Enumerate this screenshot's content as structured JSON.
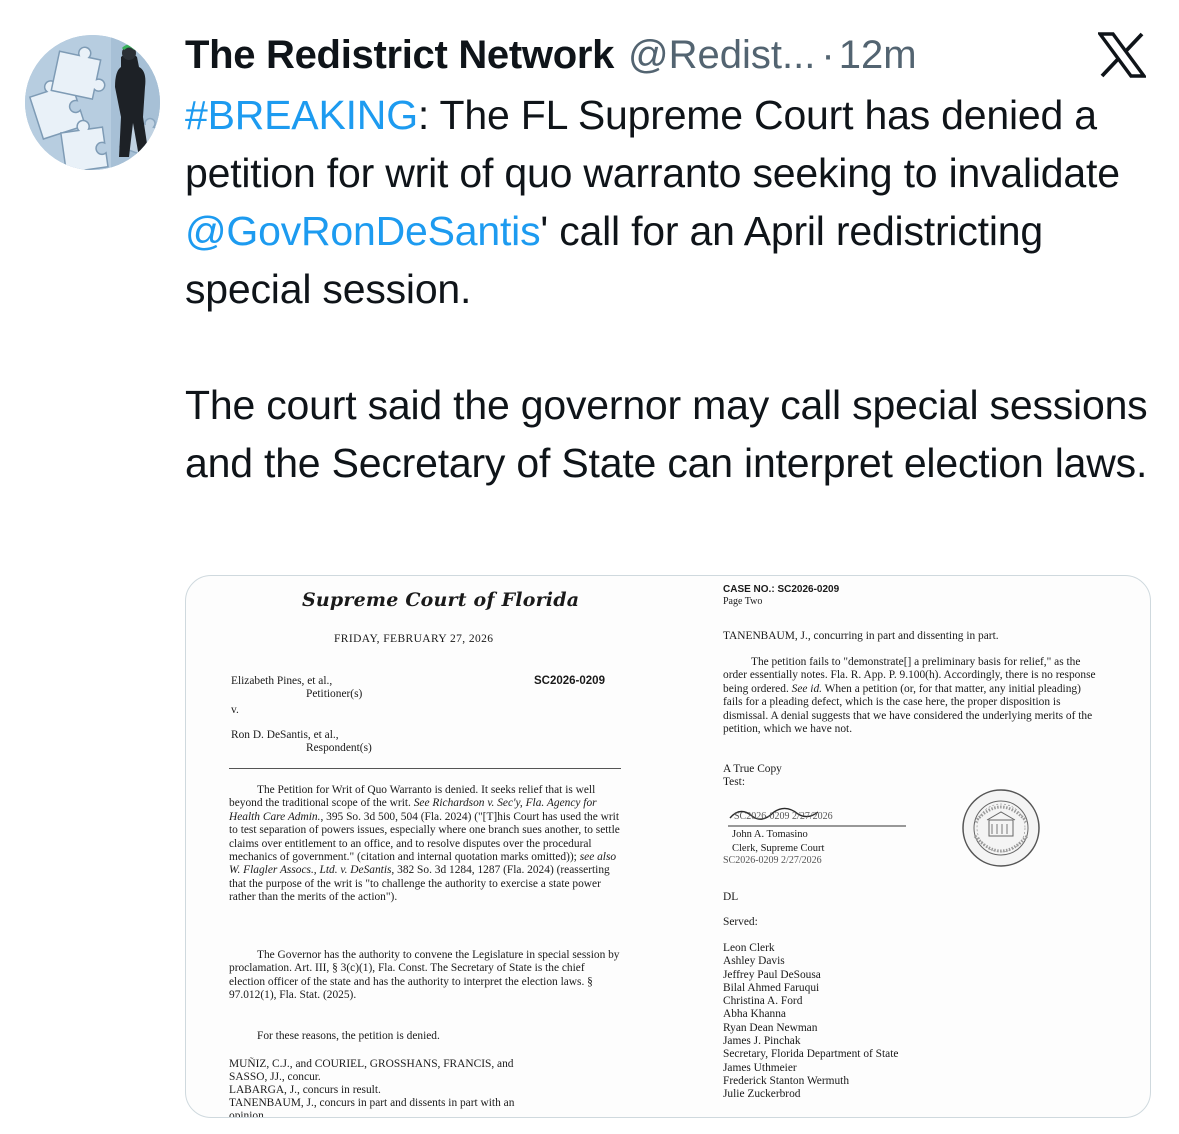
{
  "author": {
    "name": "The Redistrict Network",
    "handle": "@Redist...",
    "separator": "·",
    "time": "12m"
  },
  "tweet": {
    "hashtag": "#BREAKING",
    "p1_part1": ": The FL Supreme Court has denied a petition for writ of quo warranto seeking to invalidate ",
    "mention": "@GovRonDeSantis",
    "p1_part2": "' call for an April redistricting special session.",
    "p2": "The court said the governor may call special sessions and the Secretary of State can interpret election laws."
  },
  "document": {
    "court_title": "Supreme Court of Florida",
    "date": "FRIDAY, FEBRUARY 27, 2026",
    "petitioner_name": "Elizabeth Pines, et al.,",
    "petitioner_role": "Petitioner(s)",
    "versus": "v.",
    "respondent_name": "Ron D. DeSantis, et al.,",
    "respondent_role": "Respondent(s)",
    "case_number": "SC2026-0209",
    "para1_a": "The Petition for Writ of Quo Warranto is denied.  It seeks relief that is well beyond the traditional scope of the writ.  ",
    "para1_cite1": "See Richardson v. Sec'y, Fla. Agency for Health Care Admin.",
    "para1_b": ", 395 So. 3d 500, 504 (Fla. 2024) (\"[T]his Court has used the writ to test separation of powers issues, especially where one branch sues another, to settle claims over entitlement to an office, and to resolve disputes over the procedural mechanics of government.\" (citation and internal quotation marks omitted)); ",
    "para1_cite2": "see also W. Flagler Assocs., Ltd. v. DeSantis",
    "para1_c": ", 382 So. 3d 1284, 1287 (Fla. 2024) (reasserting that the purpose of the writ is \"to challenge the authority to exercise a state power rather than the merits of the action\").",
    "para2": "The Governor has the authority to convene the Legislature in special session by proclamation.  Art. III, § 3(c)(1), Fla. Const.  The Secretary of State is the chief election officer of the state and has the authority to interpret the election laws.  § 97.012(1), Fla. Stat. (2025).",
    "para3": "For these reasons, the petition is denied.",
    "votes1": "MUÑIZ, C.J., and COURIEL, GROSSHANS, FRANCIS, and",
    "votes2": "SASSO, JJ., concur.",
    "votes3": "LABARGA, J., concurs in result.",
    "votes4": "TANENBAUM, J., concurs in part and dissents in part with an",
    "votes5": "opinion.",
    "page2_case": "CASE NO.:  SC2026-0209",
    "page2_page": "Page Two",
    "dissent_heading": "TANENBAUM, J., concurring in part and dissenting in part.",
    "dissent_a": "The petition fails to \"demonstrate[] a preliminary basis for relief,\" as the order essentially notes. Fla. R. App. P. 9.100(h). Accordingly, there is no response being ordered.  ",
    "dissent_see": "See id.",
    "dissent_b": "  When a petition (or, for that matter, any initial pleading) fails for a pleading defect, which is the case here, the proper disposition is dismissal. A denial suggests that we have considered the underlying merits of the petition, which we have not.",
    "true_copy": "A True Copy",
    "test": "Test:",
    "sig_stamp": "SC2026-0209 2/27/2026",
    "clerk_name": "John A. Tomasino",
    "clerk_title": "Clerk, Supreme Court",
    "clerk_stamp": "SC2026-0209 2/27/2026",
    "initials": "DL",
    "served_label": "Served:",
    "served": [
      "Leon Clerk",
      "Ashley Davis",
      "Jeffrey Paul DeSousa",
      "Bilal Ahmed Faruqui",
      "Christina A. Ford",
      "Abha Khanna",
      "Ryan Dean Newman",
      "James J. Pinchak",
      "Secretary, Florida Department of State",
      "James Uthmeier",
      "Frederick Stanton Wermuth",
      "Julie Zuckerbrod"
    ]
  },
  "colors": {
    "text": "#0f1419",
    "secondary": "#536471",
    "link": "#1d9bf0",
    "border": "#cfd9de"
  },
  "icons": {
    "logo": "x-logo-icon",
    "seal": "court-seal-icon"
  }
}
